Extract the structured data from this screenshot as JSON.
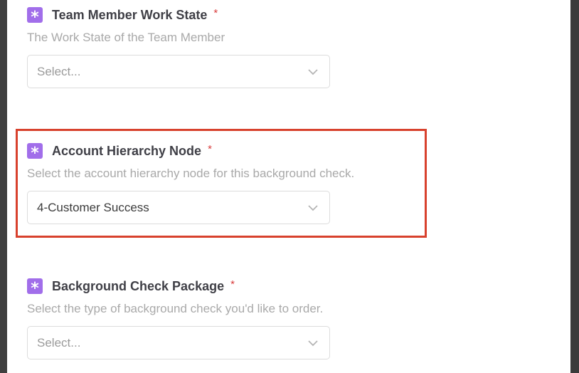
{
  "fields": [
    {
      "label": "Team Member Work State",
      "required_mark": "*",
      "description": "The Work State of the Team Member",
      "value": "Select...",
      "has_value": false
    },
    {
      "label": "Account Hierarchy Node",
      "required_mark": "*",
      "description": "Select the account hierarchy node for this background check.",
      "value": "4-Customer Success",
      "has_value": true,
      "highlighted": true
    },
    {
      "label": "Background Check Package",
      "required_mark": "*",
      "description": "Select the type of background check you'd like to order.",
      "value": "Select...",
      "has_value": false
    }
  ],
  "icons": {
    "field_icon": "asterisk-icon",
    "select_icon": "chevron-down-icon"
  },
  "colors": {
    "accent": "#a16eea",
    "required": "#d93d3d",
    "highlight": "#d8412d"
  }
}
